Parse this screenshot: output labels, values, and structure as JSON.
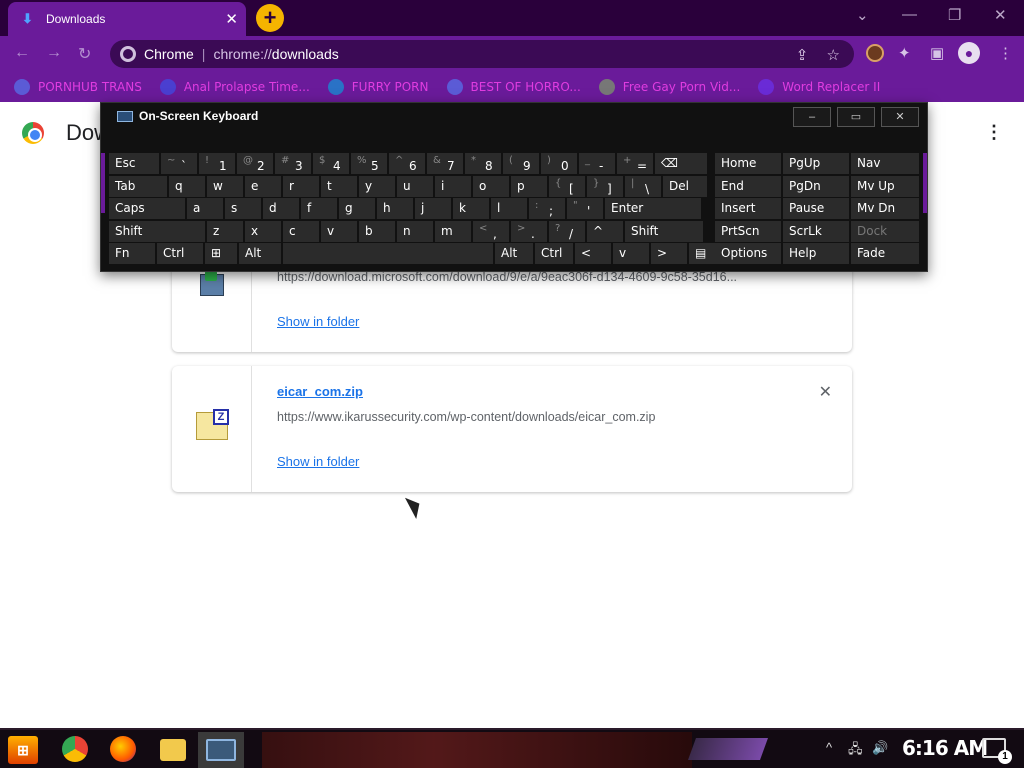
{
  "tab": {
    "title": "Downloads"
  },
  "omnibox": {
    "site": "Chrome",
    "scheme": "chrome://",
    "path": "downloads"
  },
  "bookmarks": [
    {
      "label": "PORNHUB TRANS",
      "icon": "globe-icon",
      "color": "#5b5bd6"
    },
    {
      "label": "Anal Prolapse Time...",
      "icon": "bookmark-square-icon",
      "color": "#4a3fd0"
    },
    {
      "label": "FURRY PORN",
      "icon": "caret-icon",
      "color": "#2a72c6"
    },
    {
      "label": "BEST OF HORRO...",
      "icon": "globe-icon",
      "color": "#5b5bd6"
    },
    {
      "label": "Free Gay Porn Vid...",
      "icon": "puzzle-icon",
      "color": "#777777"
    },
    {
      "label": "Word Replacer II",
      "icon": "wr-icon",
      "color": "#6a2bd6"
    }
  ],
  "page": {
    "title": "Downloads"
  },
  "downloads": [
    {
      "url": "https://download.microsoft.com/download/9/e/a/9eac306f-d134-4609-9c58-35d16...",
      "action": "Show in folder"
    },
    {
      "filename": "eicar_com.zip",
      "url": "https://www.ikarussecurity.com/wp-content/downloads/eicar_com.zip",
      "action": "Show in folder"
    }
  ],
  "osk": {
    "title": "On-Screen Keyboard",
    "controls": [
      "–",
      "▭",
      "✕"
    ],
    "row1": [
      {
        "label": "Esc"
      },
      {
        "shift": "~",
        "label": "`"
      },
      {
        "shift": "!",
        "label": "1"
      },
      {
        "shift": "@",
        "label": "2"
      },
      {
        "shift": "#",
        "label": "3"
      },
      {
        "shift": "$",
        "label": "4"
      },
      {
        "shift": "%",
        "label": "5"
      },
      {
        "shift": "^",
        "label": "6"
      },
      {
        "shift": "&",
        "label": "7"
      },
      {
        "shift": "*",
        "label": "8"
      },
      {
        "shift": "(",
        "label": "9"
      },
      {
        "shift": ")",
        "label": "0"
      },
      {
        "shift": "_",
        "label": "-"
      },
      {
        "shift": "+",
        "label": "="
      },
      {
        "label": "⌫"
      }
    ],
    "row2": [
      {
        "label": "Tab"
      },
      {
        "label": "q"
      },
      {
        "label": "w"
      },
      {
        "label": "e"
      },
      {
        "label": "r"
      },
      {
        "label": "t"
      },
      {
        "label": "y"
      },
      {
        "label": "u"
      },
      {
        "label": "i"
      },
      {
        "label": "o"
      },
      {
        "label": "p"
      },
      {
        "shift": "{",
        "label": "["
      },
      {
        "shift": "}",
        "label": "]"
      },
      {
        "shift": "|",
        "label": "\\"
      },
      {
        "label": "Del"
      }
    ],
    "row3": [
      {
        "label": "Caps"
      },
      {
        "label": "a"
      },
      {
        "label": "s"
      },
      {
        "label": "d"
      },
      {
        "label": "f"
      },
      {
        "label": "g"
      },
      {
        "label": "h"
      },
      {
        "label": "j"
      },
      {
        "label": "k"
      },
      {
        "label": "l"
      },
      {
        "shift": ":",
        "label": ";"
      },
      {
        "shift": "\"",
        "label": "'"
      },
      {
        "label": "Enter"
      }
    ],
    "row4": [
      {
        "label": "Shift"
      },
      {
        "label": "z"
      },
      {
        "label": "x"
      },
      {
        "label": "c"
      },
      {
        "label": "v"
      },
      {
        "label": "b"
      },
      {
        "label": "n"
      },
      {
        "label": "m"
      },
      {
        "shift": "<",
        "label": ","
      },
      {
        "shift": ">",
        "label": "."
      },
      {
        "shift": "?",
        "label": "/"
      },
      {
        "label": "^"
      },
      {
        "label": "Shift"
      }
    ],
    "row5": [
      {
        "label": "Fn"
      },
      {
        "label": "Ctrl"
      },
      {
        "label": "⊞"
      },
      {
        "label": "Alt"
      },
      {
        "label": ""
      },
      {
        "label": "Alt"
      },
      {
        "label": "Ctrl"
      },
      {
        "label": "<"
      },
      {
        "label": "v"
      },
      {
        "label": ">"
      },
      {
        "label": "▤"
      }
    ],
    "nav": [
      [
        "Home",
        "PgUp",
        "Nav"
      ],
      [
        "End",
        "PgDn",
        "Mv Up"
      ],
      [
        "Insert",
        "Pause",
        "Mv Dn"
      ],
      [
        "PrtScn",
        "ScrLk",
        "Dock"
      ],
      [
        "Options",
        "Help",
        "Fade"
      ]
    ]
  },
  "taskbar": {
    "time": "6:16 AM",
    "notifications": "1"
  }
}
